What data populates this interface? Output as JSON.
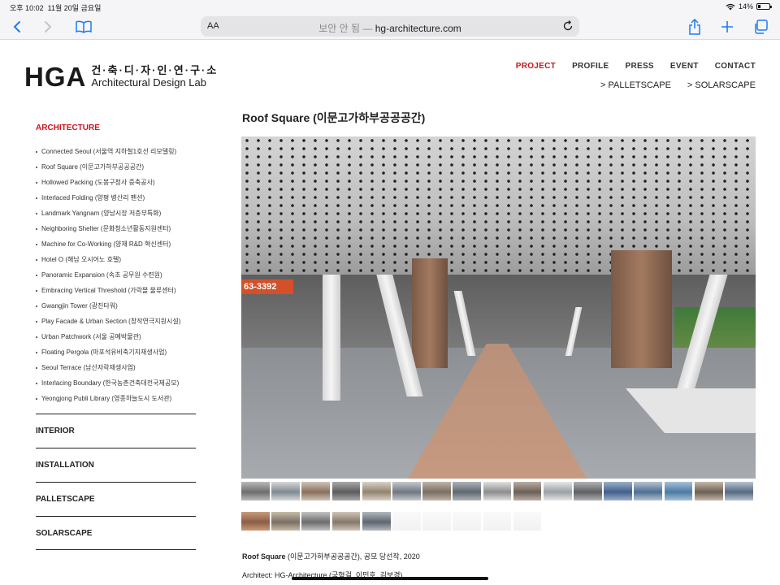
{
  "status_bar": {
    "time": "오후 10:02",
    "date": "11월 20일 금요일",
    "battery": "14%",
    "battery_fraction": 0.14
  },
  "browser": {
    "text_size_label": "AA",
    "secure_label": "보안 안 됨",
    "separator": "—",
    "host": "hg-architecture.com",
    "icons": [
      "back-icon",
      "forward-icon",
      "bookmarks-icon",
      "reload-icon",
      "share-icon",
      "plus-icon",
      "tabs-icon"
    ]
  },
  "site": {
    "logo": {
      "mark": "HGA",
      "korean": "건·축·디·자·인·연·구·소",
      "english": "Architectural Design Lab"
    },
    "nav": [
      {
        "label": "PROJECT",
        "active": true
      },
      {
        "label": "PROFILE",
        "active": false
      },
      {
        "label": "PRESS",
        "active": false
      },
      {
        "label": "EVENT",
        "active": false
      },
      {
        "label": "CONTACT",
        "active": false
      }
    ],
    "subnav": [
      "> PALLETSCAPE",
      "> SOLARSCAPE"
    ]
  },
  "sidebar": {
    "active_category": "ARCHITECTURE",
    "projects": [
      "Connected Seoul (서울역 지하철1호선 리모델링)",
      "Roof Square (이문고가하부공공공간)",
      "Hollowed Packing (도봉구청사 증축공사)",
      "Interlaced Folding (양평 병산리 펜션)",
      "Landmark Yangnam (양남시장 저층부특화)",
      "Neighboring Shelter (문화청소년활동지원센터)",
      "Machine for Co-Working (양재 R&D 혁신센터)",
      "Hotel O (해남 오시어노 호텔)",
      "Panoramic Expansion (속초 공무원 수련원)",
      "Embracing Vertical Threshold (가락몰 물류센터)",
      "Gwangjin Tower (광진타워)",
      "Play Facade & Urban Section (창작연극지원시설)",
      "Urban Patchwork (서울 공예박물관)",
      "Floating Pergola (마포석유비축기지재생사업)",
      "Seoul Terrace (남산자락재생사업)",
      "Interlacing Boundary (한국농촌건축대전국제공모)",
      "Yeongjong Publi Library (영종하늘도시 도서관)"
    ],
    "categories": [
      "INTERIOR",
      "INSTALLATION",
      "PALLETSCAPE",
      "SOLARSCAPE"
    ]
  },
  "main": {
    "title": "Roof Square (이문고가하부공공공간)",
    "hero_sign": "63-3392",
    "thumbnail_count": 22,
    "caption_bold": "Roof Square",
    "caption_rest": " (이문고가하부공공공간), 공모 당선작, 2020",
    "credit": "Architect: HG-Architecture (국형걸, 이민호, 김보경)"
  }
}
